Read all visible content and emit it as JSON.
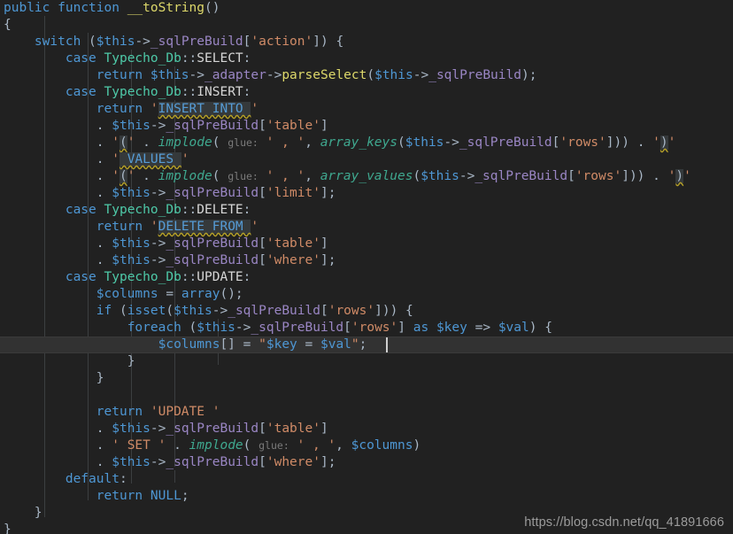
{
  "editor": {
    "background": "#212121",
    "current_line_background": "#323232",
    "default_text_color": "#a9b7c6",
    "current_line_number": 21,
    "caret": {
      "line": 21,
      "column": 44
    },
    "indent_guide_color": "#3c3f41",
    "language": "PHP",
    "colors": {
      "keyword": "#4e97d4",
      "function_name": "#ddd86a",
      "class_name": "#4ec9a8",
      "variable": "#4e97d4",
      "property": "#9a86c4",
      "string": "#d08b67",
      "builtin_function": "#3fa88f",
      "parameter_hint": "#7a7a7a",
      "sql_injection_keyword": "#569cd6",
      "sql_injection_background": "#35393b",
      "squiggly_underline": "#b5a028",
      "watermark": "#9b9b9b"
    }
  },
  "watermark": {
    "text": "https://blog.csdn.net/qq_41891666"
  },
  "code": {
    "lines": [
      "public function __toString()",
      "{",
      "    switch ($this->_sqlPreBuild['action']) {",
      "        case Typecho_Db::SELECT:",
      "            return $this->_adapter->parseSelect($this->_sqlPreBuild);",
      "        case Typecho_Db::INSERT:",
      "            return 'INSERT INTO '",
      "            . $this->_sqlPreBuild['table']",
      "            . '(' . implode( glue: ' , ', array_keys($this->_sqlPreBuild['rows'])) . ')'",
      "            . ' VALUES '",
      "            . '(' . implode( glue: ' , ', array_values($this->_sqlPreBuild['rows'])) . ')'",
      "            . $this->_sqlPreBuild['limit'];",
      "        case Typecho_Db::DELETE:",
      "            return 'DELETE FROM '",
      "            . $this->_sqlPreBuild['table']",
      "            . $this->_sqlPreBuild['where'];",
      "        case Typecho_Db::UPDATE:",
      "            $columns = array();",
      "            if (isset($this->_sqlPreBuild['rows'])) {",
      "                foreach ($this->_sqlPreBuild['rows'] as $key => $val) {",
      "                    $columns[] = \"$key = $val\";",
      "                }",
      "            }",
      "",
      "            return 'UPDATE '",
      "            . $this->_sqlPreBuild['table']",
      "            . ' SET ' . implode( glue: ' , ', $columns)",
      "            . $this->_sqlPreBuild['where'];",
      "        default:",
      "            return NULL;",
      "    }",
      "}"
    ],
    "tokens": {
      "keywords": [
        "public",
        "function",
        "switch",
        "case",
        "return",
        "if",
        "isset",
        "foreach",
        "as",
        "default"
      ],
      "class_names": [
        "Typecho_Db"
      ],
      "constants": [
        "SELECT",
        "INSERT",
        "DELETE",
        "UPDATE",
        "NULL"
      ],
      "function_names": [
        "__toString",
        "parseSelect"
      ],
      "builtins": [
        "implode",
        "array_keys",
        "array_values",
        "array"
      ],
      "variables": [
        "$this",
        "$columns",
        "$key",
        "$val"
      ],
      "properties": [
        "_adapter",
        "_sqlPreBuild"
      ],
      "strings": [
        "'action'",
        "'table'",
        "'rows'",
        "'where'",
        "'limit'",
        "'INSERT INTO '",
        "' VALUES '",
        "'DELETE FROM '",
        "'UPDATE '",
        "' SET '",
        "'('",
        "')'",
        "' , '"
      ],
      "parameter_hints": [
        "glue:"
      ],
      "sql_injected_keywords": [
        "INSERT INTO",
        "VALUES",
        "DELETE FROM",
        "(",
        ")"
      ]
    }
  }
}
